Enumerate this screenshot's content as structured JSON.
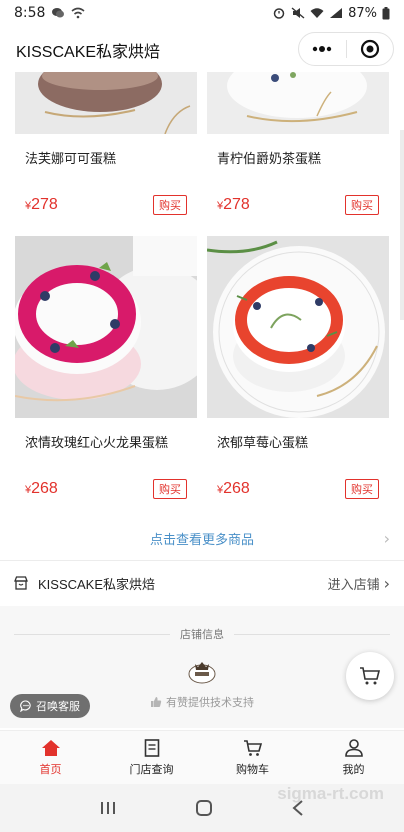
{
  "status": {
    "time": "8:58",
    "battery": "87%"
  },
  "header": {
    "title": "KISSCAKE私家烘焙"
  },
  "products": [
    {
      "name": "法芙娜可可蛋糕",
      "currency": "¥",
      "price": "278",
      "buy_label": "购买"
    },
    {
      "name": "青柠伯爵奶茶蛋糕",
      "currency": "¥",
      "price": "278",
      "buy_label": "购买"
    },
    {
      "name": "浓情玫瑰红心火龙果蛋糕",
      "currency": "¥",
      "price": "268",
      "buy_label": "购买"
    },
    {
      "name": "浓郁草莓心蛋糕",
      "currency": "¥",
      "price": "268",
      "buy_label": "购买"
    }
  ],
  "more_link": "点击查看更多商品",
  "store": {
    "name": "KISSCAKE私家烘焙",
    "enter_label": "进入店铺"
  },
  "info": {
    "title": "店铺信息",
    "powered_by": "有赞提供技术支持"
  },
  "service_button": "召唤客服",
  "tabs": [
    {
      "label": "首页",
      "icon": "home-icon",
      "active": true
    },
    {
      "label": "门店查询",
      "icon": "document-icon",
      "active": false
    },
    {
      "label": "购物车",
      "icon": "cart-icon",
      "active": false
    },
    {
      "label": "我的",
      "icon": "user-icon",
      "active": false
    }
  ],
  "watermark": "sigma-rt.com",
  "colors": {
    "accent": "#e2322c",
    "link": "#4a90c8"
  }
}
